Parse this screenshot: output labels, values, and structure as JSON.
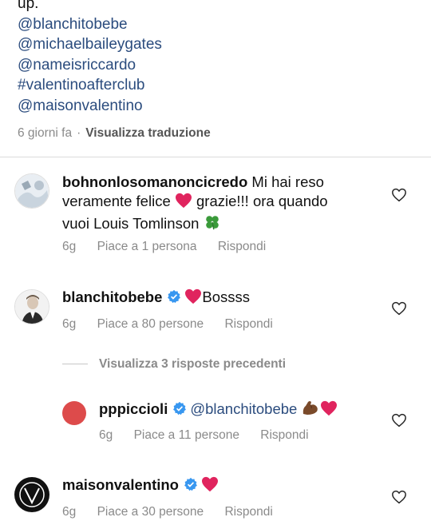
{
  "caption": {
    "first_line": "up.",
    "tags": [
      "@blanchitobebe",
      "@michaelbaileygates",
      "@nameisriccardo",
      "#valentinoafterclub",
      "@maisonvalentino"
    ],
    "time": "6 giorni fa",
    "separator": "·",
    "translate": "Visualizza traduzione"
  },
  "comments": [
    {
      "username": "bohnonlosomanoncicredo",
      "text1": " Mi hai reso",
      "text2": "veramente felice ",
      "text3": " grazie!!! ora quando",
      "text4": "vuoi Louis Tomlinson ",
      "time": "6g",
      "likes": "Piace a 1 persona",
      "reply": "Rispondi"
    },
    {
      "username": "blanchitobebe",
      "text": "Bossss",
      "time": "6g",
      "likes": "Piace a 80 persone",
      "reply": "Rispondi"
    },
    {
      "username": "maisonvalentino",
      "time": "6g",
      "likes": "Piace a 30 persone",
      "reply": "Rispondi"
    }
  ],
  "view_replies": "Visualizza 3 risposte precedenti",
  "reply": {
    "username": "pppiccioli",
    "text": "@blanchitobebe ",
    "time": "6g",
    "likes": "Piace a 11 persone",
    "reply_label": "Rispondi"
  },
  "colors": {
    "link": "#2b4c7e",
    "verified": "#3897f0",
    "heart": "#e0245e",
    "meta": "#8a8a8a"
  },
  "icons": [
    "verified-badge-icon",
    "heart-outline-icon",
    "red-heart-emoji",
    "clover-emoji",
    "flexed-biceps-emoji"
  ]
}
